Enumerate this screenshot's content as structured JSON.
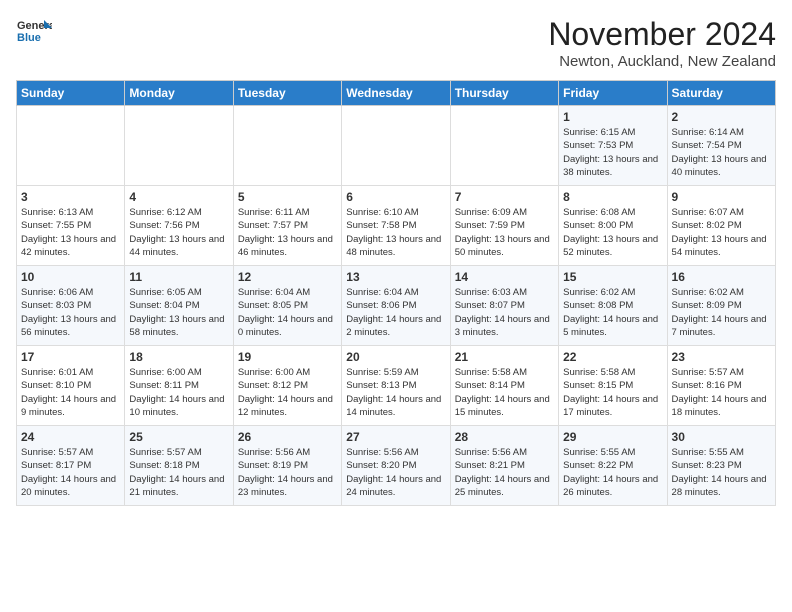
{
  "logo": {
    "line1": "General",
    "line2": "Blue"
  },
  "title": "November 2024",
  "location": "Newton, Auckland, New Zealand",
  "weekdays": [
    "Sunday",
    "Monday",
    "Tuesday",
    "Wednesday",
    "Thursday",
    "Friday",
    "Saturday"
  ],
  "weeks": [
    [
      {
        "day": "",
        "detail": ""
      },
      {
        "day": "",
        "detail": ""
      },
      {
        "day": "",
        "detail": ""
      },
      {
        "day": "",
        "detail": ""
      },
      {
        "day": "",
        "detail": ""
      },
      {
        "day": "1",
        "detail": "Sunrise: 6:15 AM\nSunset: 7:53 PM\nDaylight: 13 hours and 38 minutes."
      },
      {
        "day": "2",
        "detail": "Sunrise: 6:14 AM\nSunset: 7:54 PM\nDaylight: 13 hours and 40 minutes."
      }
    ],
    [
      {
        "day": "3",
        "detail": "Sunrise: 6:13 AM\nSunset: 7:55 PM\nDaylight: 13 hours and 42 minutes."
      },
      {
        "day": "4",
        "detail": "Sunrise: 6:12 AM\nSunset: 7:56 PM\nDaylight: 13 hours and 44 minutes."
      },
      {
        "day": "5",
        "detail": "Sunrise: 6:11 AM\nSunset: 7:57 PM\nDaylight: 13 hours and 46 minutes."
      },
      {
        "day": "6",
        "detail": "Sunrise: 6:10 AM\nSunset: 7:58 PM\nDaylight: 13 hours and 48 minutes."
      },
      {
        "day": "7",
        "detail": "Sunrise: 6:09 AM\nSunset: 7:59 PM\nDaylight: 13 hours and 50 minutes."
      },
      {
        "day": "8",
        "detail": "Sunrise: 6:08 AM\nSunset: 8:00 PM\nDaylight: 13 hours and 52 minutes."
      },
      {
        "day": "9",
        "detail": "Sunrise: 6:07 AM\nSunset: 8:02 PM\nDaylight: 13 hours and 54 minutes."
      }
    ],
    [
      {
        "day": "10",
        "detail": "Sunrise: 6:06 AM\nSunset: 8:03 PM\nDaylight: 13 hours and 56 minutes."
      },
      {
        "day": "11",
        "detail": "Sunrise: 6:05 AM\nSunset: 8:04 PM\nDaylight: 13 hours and 58 minutes."
      },
      {
        "day": "12",
        "detail": "Sunrise: 6:04 AM\nSunset: 8:05 PM\nDaylight: 14 hours and 0 minutes."
      },
      {
        "day": "13",
        "detail": "Sunrise: 6:04 AM\nSunset: 8:06 PM\nDaylight: 14 hours and 2 minutes."
      },
      {
        "day": "14",
        "detail": "Sunrise: 6:03 AM\nSunset: 8:07 PM\nDaylight: 14 hours and 3 minutes."
      },
      {
        "day": "15",
        "detail": "Sunrise: 6:02 AM\nSunset: 8:08 PM\nDaylight: 14 hours and 5 minutes."
      },
      {
        "day": "16",
        "detail": "Sunrise: 6:02 AM\nSunset: 8:09 PM\nDaylight: 14 hours and 7 minutes."
      }
    ],
    [
      {
        "day": "17",
        "detail": "Sunrise: 6:01 AM\nSunset: 8:10 PM\nDaylight: 14 hours and 9 minutes."
      },
      {
        "day": "18",
        "detail": "Sunrise: 6:00 AM\nSunset: 8:11 PM\nDaylight: 14 hours and 10 minutes."
      },
      {
        "day": "19",
        "detail": "Sunrise: 6:00 AM\nSunset: 8:12 PM\nDaylight: 14 hours and 12 minutes."
      },
      {
        "day": "20",
        "detail": "Sunrise: 5:59 AM\nSunset: 8:13 PM\nDaylight: 14 hours and 14 minutes."
      },
      {
        "day": "21",
        "detail": "Sunrise: 5:58 AM\nSunset: 8:14 PM\nDaylight: 14 hours and 15 minutes."
      },
      {
        "day": "22",
        "detail": "Sunrise: 5:58 AM\nSunset: 8:15 PM\nDaylight: 14 hours and 17 minutes."
      },
      {
        "day": "23",
        "detail": "Sunrise: 5:57 AM\nSunset: 8:16 PM\nDaylight: 14 hours and 18 minutes."
      }
    ],
    [
      {
        "day": "24",
        "detail": "Sunrise: 5:57 AM\nSunset: 8:17 PM\nDaylight: 14 hours and 20 minutes."
      },
      {
        "day": "25",
        "detail": "Sunrise: 5:57 AM\nSunset: 8:18 PM\nDaylight: 14 hours and 21 minutes."
      },
      {
        "day": "26",
        "detail": "Sunrise: 5:56 AM\nSunset: 8:19 PM\nDaylight: 14 hours and 23 minutes."
      },
      {
        "day": "27",
        "detail": "Sunrise: 5:56 AM\nSunset: 8:20 PM\nDaylight: 14 hours and 24 minutes."
      },
      {
        "day": "28",
        "detail": "Sunrise: 5:56 AM\nSunset: 8:21 PM\nDaylight: 14 hours and 25 minutes."
      },
      {
        "day": "29",
        "detail": "Sunrise: 5:55 AM\nSunset: 8:22 PM\nDaylight: 14 hours and 26 minutes."
      },
      {
        "day": "30",
        "detail": "Sunrise: 5:55 AM\nSunset: 8:23 PM\nDaylight: 14 hours and 28 minutes."
      }
    ]
  ]
}
